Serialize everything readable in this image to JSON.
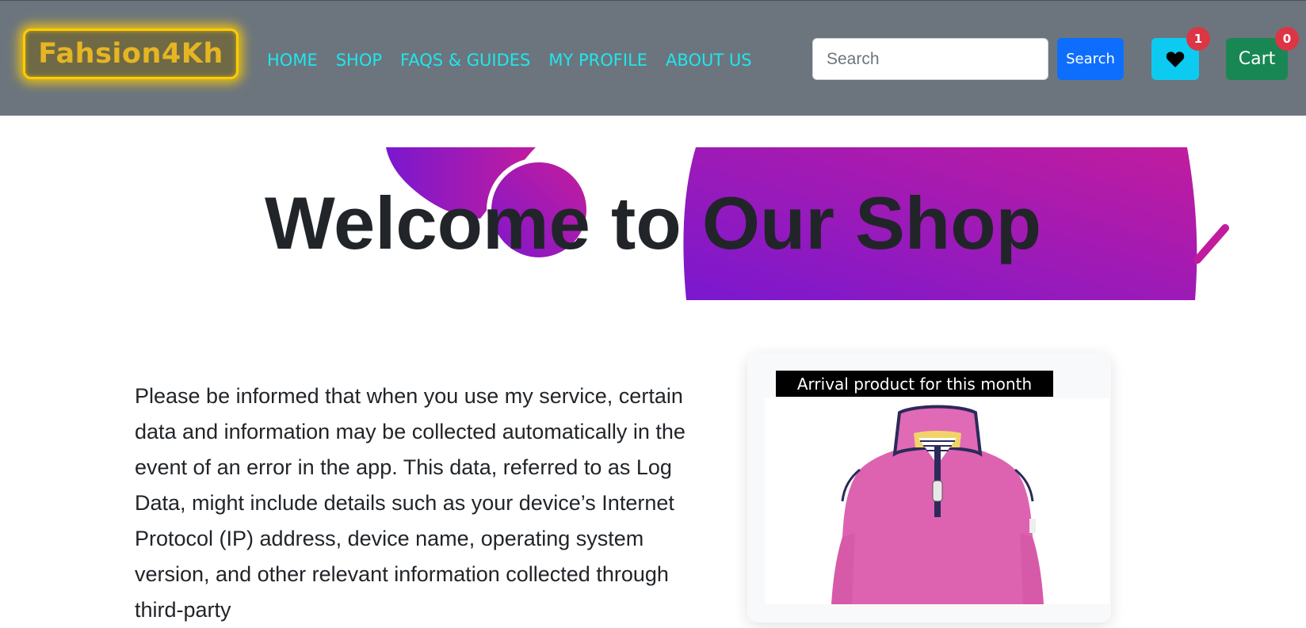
{
  "navbar": {
    "brand": "Fahsion4Kh",
    "links": [
      "HOME",
      "SHOP",
      "FAQS & GUIDES",
      "MY PROFILE",
      "ABOUT US"
    ],
    "search": {
      "placeholder": "Search",
      "value": "",
      "button_label": "Search"
    },
    "wishlist": {
      "icon": "heart-icon",
      "count": "1"
    },
    "cart": {
      "label": "Cart",
      "count": "0"
    }
  },
  "colors": {
    "navbar_bg": "#6c757d",
    "brand_border": "#ffcc00",
    "nav_link": "#1ee7ee",
    "search_button": "#0d6efd",
    "wishlist_button": "#0dcaf0",
    "cart_button": "#198754",
    "badge": "#dc3545",
    "gradient_start": "#7a18cf",
    "gradient_end": "#c11c9e"
  },
  "hero": {
    "title": "Welcome to Our Shop"
  },
  "content": {
    "text": "Please be informed that when you use my service, certain data and information may be collected automatically in the event of an error in the app. This data, referred to as Log Data, might include details such as your device’s Internet Protocol (IP) address, device name, operating system version, and other relevant information collected through third-party"
  },
  "product_card": {
    "label": "Arrival product for this month",
    "image": "pink-half-zip-sweatshirt"
  }
}
